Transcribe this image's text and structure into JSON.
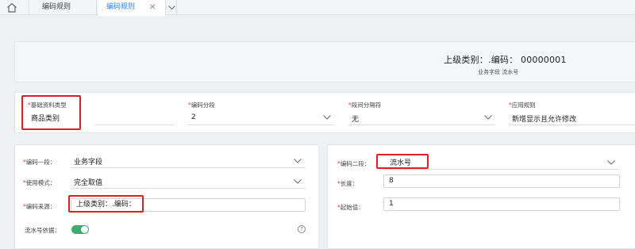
{
  "tabs": [
    {
      "label": "编码规则"
    },
    {
      "label": "编码规则"
    }
  ],
  "icons": {
    "home": "home-icon",
    "close": "close-icon",
    "dropdown": "chevron-down-icon",
    "help": "help-icon"
  },
  "summary": {
    "code_line": "上级类别：.编码： 00000001",
    "sub_line": "业务字段 流水号"
  },
  "fields": {
    "base_type": {
      "label": "基础资料类型",
      "value": "商品类别"
    },
    "segment_count": {
      "label": "编码分段",
      "value": "2"
    },
    "separator": {
      "label": "段间分隔符",
      "value": "无"
    },
    "apply_rule": {
      "label": "应用规则",
      "value": "新增显示且允许修改"
    }
  },
  "segment1": {
    "seg_label": "编码一段：",
    "seg_value": "业务字段",
    "mode_label": "使用模式：",
    "mode_value": "完全取值",
    "source_label": "编码来源：",
    "source_value": "上级类别：.编码：",
    "serial_label": "流水号依据：",
    "serial_on": true
  },
  "segment2": {
    "seg_label": "编码二段：",
    "seg_value": "流水号",
    "length_label": "长度：",
    "length_value": "8",
    "start_label": "起始值：",
    "start_value": "1"
  },
  "colors": {
    "accent": "#2f7ee8",
    "required": "#e03b3b",
    "toggle_on": "#3eac6e",
    "highlight": "#e02020"
  }
}
